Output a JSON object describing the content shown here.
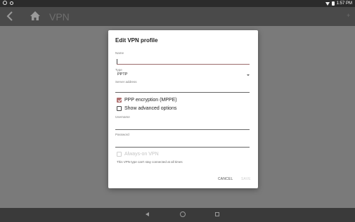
{
  "status_bar": {
    "time": "1:57 PM",
    "icons": [
      "circle-app-icon",
      "circle-sync-icon",
      "wifi-icon",
      "battery-icon"
    ]
  },
  "app_bar": {
    "title": "VPN",
    "icons": [
      "back-arrow-icon",
      "home-icon",
      "add-icon"
    ]
  },
  "dialog": {
    "title": "Edit VPN profile",
    "name": {
      "label": "Name",
      "value": ""
    },
    "type": {
      "label": "Type",
      "value": "PPTP"
    },
    "server": {
      "label": "Server address",
      "value": ""
    },
    "mppe": {
      "label": "PPP encryption (MPPE)",
      "checked": true
    },
    "advanced": {
      "label": "Show advanced options",
      "checked": false
    },
    "username": {
      "label": "Username",
      "value": ""
    },
    "password": {
      "label": "Password",
      "value": ""
    },
    "always_on": {
      "label": "Always-on VPN",
      "checked": false,
      "enabled": false
    },
    "always_on_note": "This VPN type can't stay connected at all times",
    "cancel_label": "CANCEL",
    "save_label": "SAVE"
  },
  "nav_bar": {
    "icons": [
      "nav-back-icon",
      "nav-home-icon",
      "nav-recents-icon"
    ]
  },
  "colors": {
    "accent": "#b07070",
    "dialog_bg": "#ffffff",
    "scrim": "#7a7a7a"
  }
}
